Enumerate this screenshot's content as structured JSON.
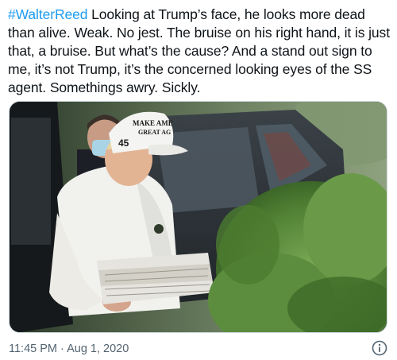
{
  "tweet": {
    "hashtag": "#WalterReed",
    "text": " Looking at Trump’s face, he looks more dead than alive. Weak. No jest. The bruise on his right hand, it is just that, a bruise. But what’s the cause? And a stand out sign to me, it’s not Trump, it’s the concerned looking eyes of the SS agent. Somethings awry. Sickly.",
    "time": "11:45 PM",
    "separator": " · ",
    "date": "Aug 1, 2020"
  },
  "photo": {
    "cap_text_line1": "MAKE AME",
    "cap_text_line2": "GREAT AG",
    "cap_number": "45",
    "colors": {
      "shirt": "#f1f1ee",
      "cap": "#f4f4f2",
      "car": "#2a2f33",
      "bush": "#5a8a3c",
      "background": "#6b7d5e"
    }
  },
  "icons": {
    "info": "info-icon"
  }
}
